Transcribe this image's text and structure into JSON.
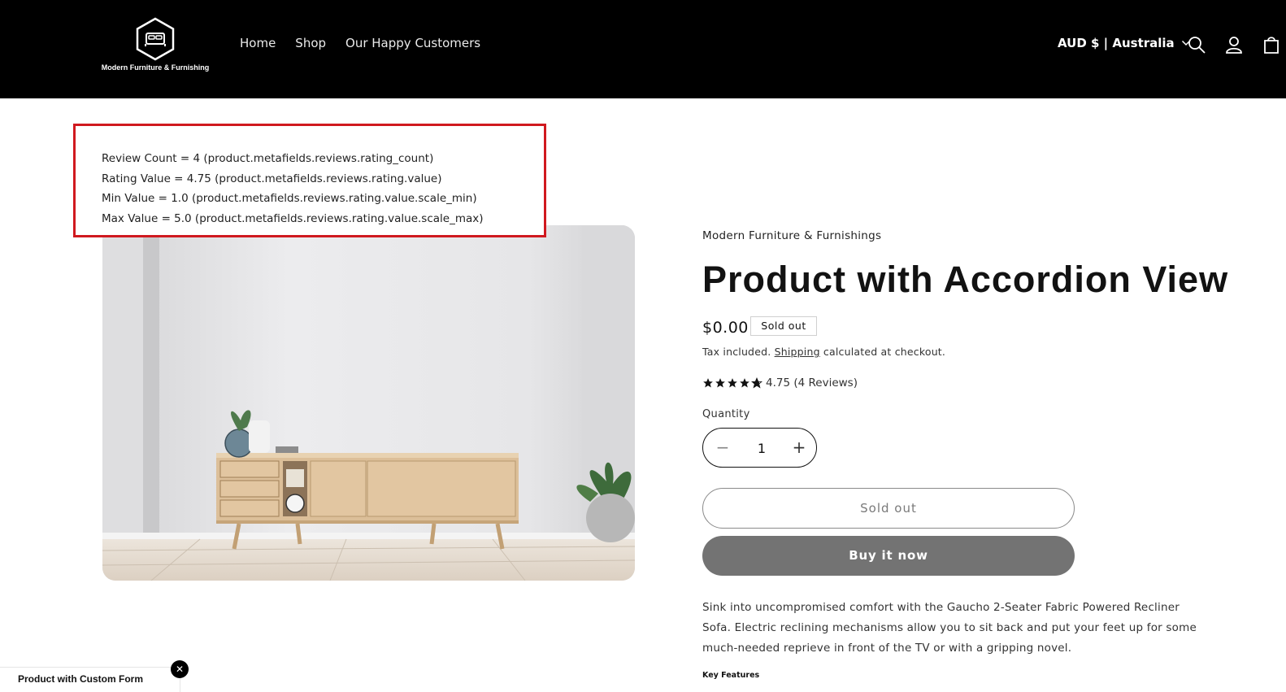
{
  "header": {
    "logo_text": "Modern Furniture & Furnishing",
    "nav": [
      {
        "label": "Home"
      },
      {
        "label": "Shop"
      },
      {
        "label": "Our Happy Customers"
      }
    ],
    "country_selector": "AUD $ | Australia",
    "icons": [
      "search-icon",
      "account-icon",
      "cart-icon"
    ]
  },
  "debug_box": {
    "lines": [
      "Review Count = 4 (product.metafields.reviews.rating_count)",
      "Rating Value = 4.75 (product.metafields.reviews.rating.value)",
      "Min Value = 1.0 (product.metafields.reviews.rating.value.scale_min)",
      "Max Value = 5.0 (product.metafields.reviews.rating.value.scale_max)"
    ],
    "border_color": "#d0191f"
  },
  "product": {
    "vendor": "Modern Furniture & Furnishings",
    "title": "Product with Accordion View",
    "price": "$0.00",
    "badge": "Sold out",
    "tax_prefix": "Tax included.",
    "tax_link": "Shipping",
    "tax_suffix": "calculated at checkout.",
    "rating": 4.75,
    "rating_text": "4.75 (4 Reviews)",
    "quantity_label": "Quantity",
    "quantity": "1",
    "soldout_button": "Sold out",
    "buy_button": "Buy it now",
    "description": "Sink into uncompromised comfort with the Gaucho 2-Seater Fabric Powered Recliner Sofa. Electric reclining mechanisms allow you to sit back and put your feet up for some much-needed reprieve in front of the TV or with a gripping novel.",
    "key_features_label": "Key Features"
  },
  "popup": {
    "label": "Product with Custom Form",
    "close": "✕"
  },
  "colors": {
    "header_bg": "#000000",
    "buy_button_bg": "#737373",
    "text": "#121212"
  }
}
